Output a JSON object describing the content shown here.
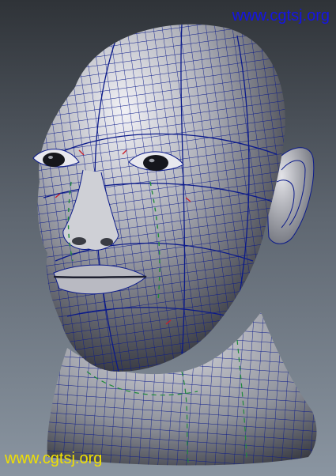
{
  "viewport": {
    "subject": "wireframe-head-model",
    "colors": {
      "background_top": "#2f3338",
      "background_bottom": "#8a95a1",
      "surface_light": "#e8e8ee",
      "surface_shadow": "#2c2e36",
      "wire": "#0b1a8a",
      "edge_red": "#c8202a",
      "edge_green": "#1f8a3a"
    }
  },
  "watermarks": {
    "top": {
      "text": "www.cgtsj.org",
      "color": "#1414e6"
    },
    "bottom": {
      "text": "www.cgtsj.org",
      "color": "#f0e000"
    }
  }
}
